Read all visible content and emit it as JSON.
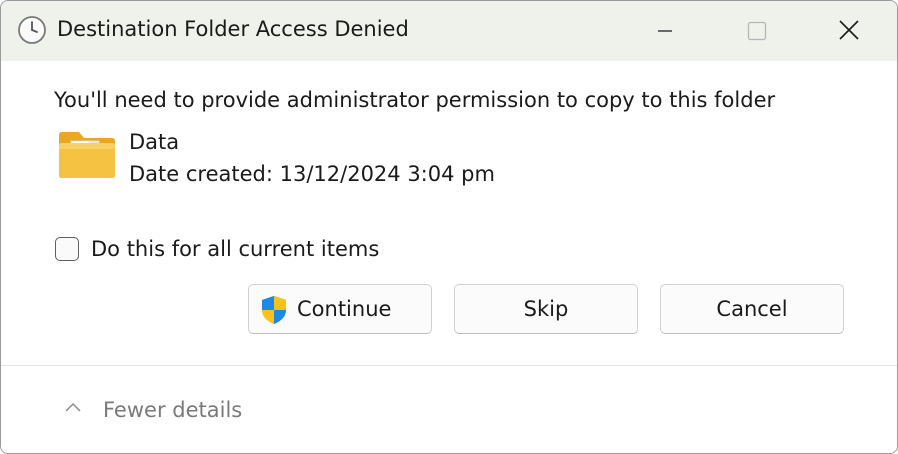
{
  "window": {
    "title": "Destination Folder Access Denied",
    "title_icon": "clock-icon",
    "controls": [
      "minimize-icon",
      "maximize-icon",
      "close-icon"
    ]
  },
  "message": "You'll need to provide administrator permission to copy to this folder",
  "item": {
    "icon": "folder-icon",
    "name": "Data",
    "date_created": "Date created: 13/12/2024 3:04 pm"
  },
  "checkbox": {
    "label": "Do this for all current items",
    "checked": false
  },
  "buttons": {
    "continue": {
      "label": "Continue",
      "icon": "uac-shield-icon"
    },
    "skip": {
      "label": "Skip"
    },
    "cancel": {
      "label": "Cancel"
    }
  },
  "footer": {
    "toggle_label": "Fewer details",
    "toggle_icon": "chevron-up-icon"
  },
  "colors": {
    "titlebar_bg": "#eef2ea",
    "folder_yellow": "#f5c242",
    "shield_blue": "#1e88e5",
    "shield_yellow": "#f9c21b"
  }
}
